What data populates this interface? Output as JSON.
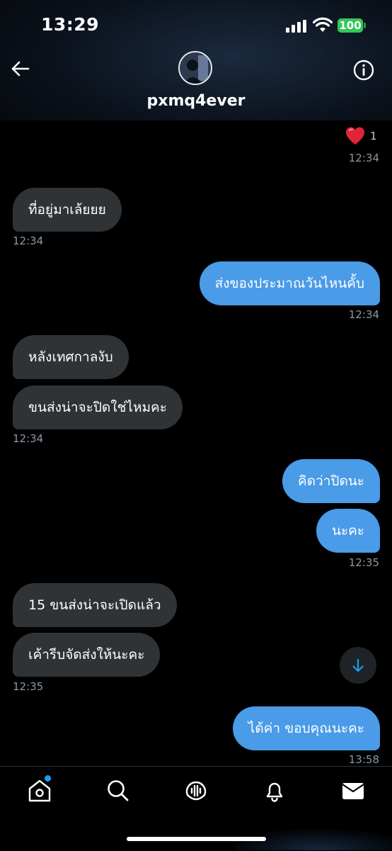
{
  "status_bar": {
    "time": "13:29",
    "battery": "100"
  },
  "header": {
    "username": "pxmq4ever"
  },
  "reaction": {
    "emoji": "❤️",
    "count": "1",
    "time": "12:34"
  },
  "messages": [
    {
      "dir": "in",
      "text": "ที่อยู่มาเล้ยยย",
      "time": "12:34"
    },
    {
      "dir": "out",
      "text": "ส่งของประมาณวันไหนคั้บ",
      "time": "12:34"
    },
    {
      "dir": "in",
      "text": "หลังเทศกาลงับ"
    },
    {
      "dir": "in",
      "text": "ขนส่งน่าจะปิดใช่ไหมคะ",
      "time": "12:34"
    },
    {
      "dir": "out",
      "text": "คิดว่าปิดนะ"
    },
    {
      "dir": "out",
      "text": "นะคะ",
      "time": "12:35"
    },
    {
      "dir": "in",
      "text": "15 ขนส่งน่าจะเปิดแล้ว"
    },
    {
      "dir": "in",
      "text": "เค้ารีบจัดส่งให้นะคะ",
      "time": "12:35"
    },
    {
      "dir": "out",
      "text": "ได้ค่า ขอบคุณนะคะ",
      "time": "13:58"
    }
  ],
  "nav": [
    "home-icon",
    "search-icon",
    "spaces-icon",
    "notifications-icon",
    "messages-icon"
  ],
  "colors": {
    "outgoing": "#4a9be8",
    "incoming": "#2f3336",
    "accent": "#1d9bf0"
  }
}
